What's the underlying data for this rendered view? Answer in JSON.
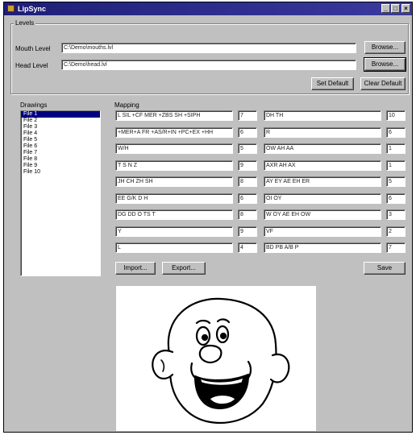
{
  "window": {
    "title": "LipSync"
  },
  "levels": {
    "group_label": "Levels",
    "mouth_label": "Mouth Level",
    "mouth_value": "C:\\Demo\\mouths.lvl",
    "head_label": "Head Level",
    "head_value": "C:\\Demo\\head.lvl",
    "browse_label": "Browse...",
    "set_default_label": "Set Default",
    "clear_default_label": "Clear Default"
  },
  "drawings": {
    "label": "Drawings",
    "items": [
      "File 1",
      "File 2",
      "File 3",
      "File 4",
      "File 5",
      "File 6",
      "File 7",
      "File 8",
      "File 9",
      "File 10"
    ],
    "selected_index": 0
  },
  "mapping": {
    "label": "Mapping",
    "left": [
      {
        "phonemes": "L SIL +CF MER +ZBS SH +SIPH",
        "value": "7"
      },
      {
        "phonemes": "+MER+A FR +AS/R+IN +PC+EX +HH",
        "value": "6"
      },
      {
        "phonemes": "W/H",
        "value": "5"
      },
      {
        "phonemes": "T S N Z",
        "value": "9"
      },
      {
        "phonemes": "JH CH ZH SH",
        "value": "8"
      },
      {
        "phonemes": "EE G/K D H",
        "value": "6"
      },
      {
        "phonemes": "DG DD O TS T",
        "value": "8"
      },
      {
        "phonemes": "Y",
        "value": "9"
      },
      {
        "phonemes": "L",
        "value": "4"
      }
    ],
    "right": [
      {
        "phonemes": "DH TH",
        "value": "10"
      },
      {
        "phonemes": "R",
        "value": "6"
      },
      {
        "phonemes": "OW AH AA",
        "value": "1"
      },
      {
        "phonemes": "AXR AH AX",
        "value": "1"
      },
      {
        "phonemes": "AY EY AE EH ER",
        "value": "5"
      },
      {
        "phonemes": "OI OY",
        "value": "6"
      },
      {
        "phonemes": "W OY AE EH OW",
        "value": "3"
      },
      {
        "phonemes": "VF",
        "value": "2"
      },
      {
        "phonemes": "BD PB A/B P",
        "value": "7"
      }
    ],
    "import_label": "Import...",
    "export_label": "Export...",
    "save_label": "Save"
  },
  "colors": {
    "titlebar": "#1e1e78",
    "face": "#c0c0c0",
    "selection": "#000080"
  }
}
